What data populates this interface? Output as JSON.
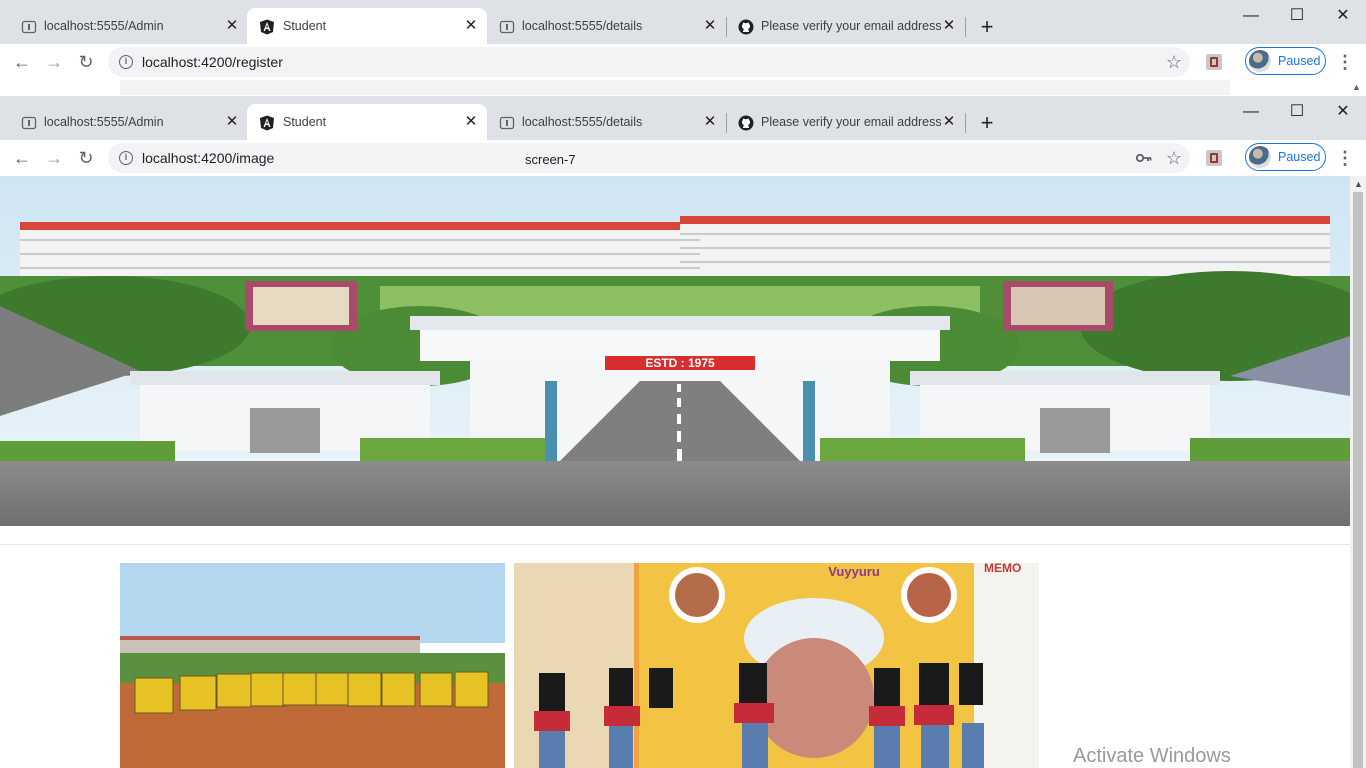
{
  "window1": {
    "tabs": [
      {
        "title": "localhost:5555/Admin"
      },
      {
        "title": "Student"
      },
      {
        "title": "localhost:5555/details"
      },
      {
        "title": "Please verify your email address"
      }
    ],
    "url": "localhost:4200/register",
    "profile_label": "Paused"
  },
  "window2": {
    "tabs": [
      {
        "title": "localhost:5555/Admin"
      },
      {
        "title": "Student"
      },
      {
        "title": "localhost:5555/details"
      },
      {
        "title": "Please verify your email address"
      }
    ],
    "url": "localhost:4200/image",
    "profile_label": "Paused"
  },
  "screen_label": "screen-7",
  "page": {
    "banner_sign": "ESTD : 1975",
    "poster_text": "Vuyyuru",
    "poster_side_text": "MEMO"
  },
  "watermark": "Activate Windows"
}
